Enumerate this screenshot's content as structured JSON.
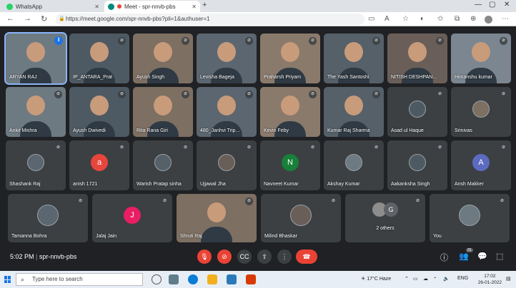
{
  "browser": {
    "tabs": [
      {
        "title": "WhatsApp",
        "active": false
      },
      {
        "title": "Meet - spr-nnvb-pbs",
        "active": true
      }
    ],
    "url": "https://meet.google.com/spr-nnvb-pbs?pli=1&authuser=1"
  },
  "participants": [
    {
      "name": "ARYAN RAJ",
      "kind": "video",
      "speaking": true
    },
    {
      "name": "IP_ANTARA_Prat",
      "kind": "video"
    },
    {
      "name": "Ayush Singh",
      "kind": "video"
    },
    {
      "name": "Levisha Bageja",
      "kind": "video"
    },
    {
      "name": "Praharsh Priyam",
      "kind": "video"
    },
    {
      "name": "The Yash Santoshi",
      "kind": "video"
    },
    {
      "name": "NITISH DESHPAN...",
      "kind": "video"
    },
    {
      "name": "Himanshu kumar",
      "kind": "video"
    },
    {
      "name": "Ankit Mishra",
      "kind": "video"
    },
    {
      "name": "Ayush Dwivedi",
      "kind": "video"
    },
    {
      "name": "Rita Rana Giri",
      "kind": "video"
    },
    {
      "name": "480_Janhvi Trip...",
      "kind": "video"
    },
    {
      "name": "Kevin Feby",
      "kind": "video"
    },
    {
      "name": "Kumar Raj Sharma",
      "kind": "video"
    },
    {
      "name": "Asad ul Haque",
      "kind": "avatar"
    },
    {
      "name": "Srinivas",
      "kind": "avatar"
    },
    {
      "name": "Shashank Raj",
      "kind": "avatar"
    },
    {
      "name": "anish 1721",
      "kind": "letter",
      "letter": "a",
      "color": "#e8453c"
    },
    {
      "name": "Warish Pratap sinha",
      "kind": "avatar"
    },
    {
      "name": "Ujjawal Jha",
      "kind": "avatar"
    },
    {
      "name": "Navneet Kumar",
      "kind": "letter",
      "letter": "N",
      "color": "#188038"
    },
    {
      "name": "Akshay Kumar",
      "kind": "avatar"
    },
    {
      "name": "Aakanksha Singh",
      "kind": "avatar"
    },
    {
      "name": "Ansh Makker",
      "kind": "letter",
      "letter": "A",
      "color": "#5c6bc0"
    },
    {
      "name": "Tamanna Bohra",
      "kind": "avatar"
    },
    {
      "name": "Jalaj Jain",
      "kind": "letter",
      "letter": "J",
      "color": "#e91e63"
    },
    {
      "name": "Shruti Raj",
      "kind": "video"
    },
    {
      "name": "Milind Bhaskar",
      "kind": "avatar"
    },
    {
      "name": "2 others",
      "kind": "others",
      "letter": "G"
    },
    {
      "name": "You",
      "kind": "avatar"
    }
  ],
  "controls": {
    "time": "5:02 PM",
    "meeting_code": "spr-nnvb-pbs",
    "participant_count": "31"
  },
  "taskbar": {
    "search_placeholder": "Type here to search",
    "weather": "17°C Haze",
    "language": "ENG",
    "time": "17:02",
    "date": "26-01-2022"
  }
}
